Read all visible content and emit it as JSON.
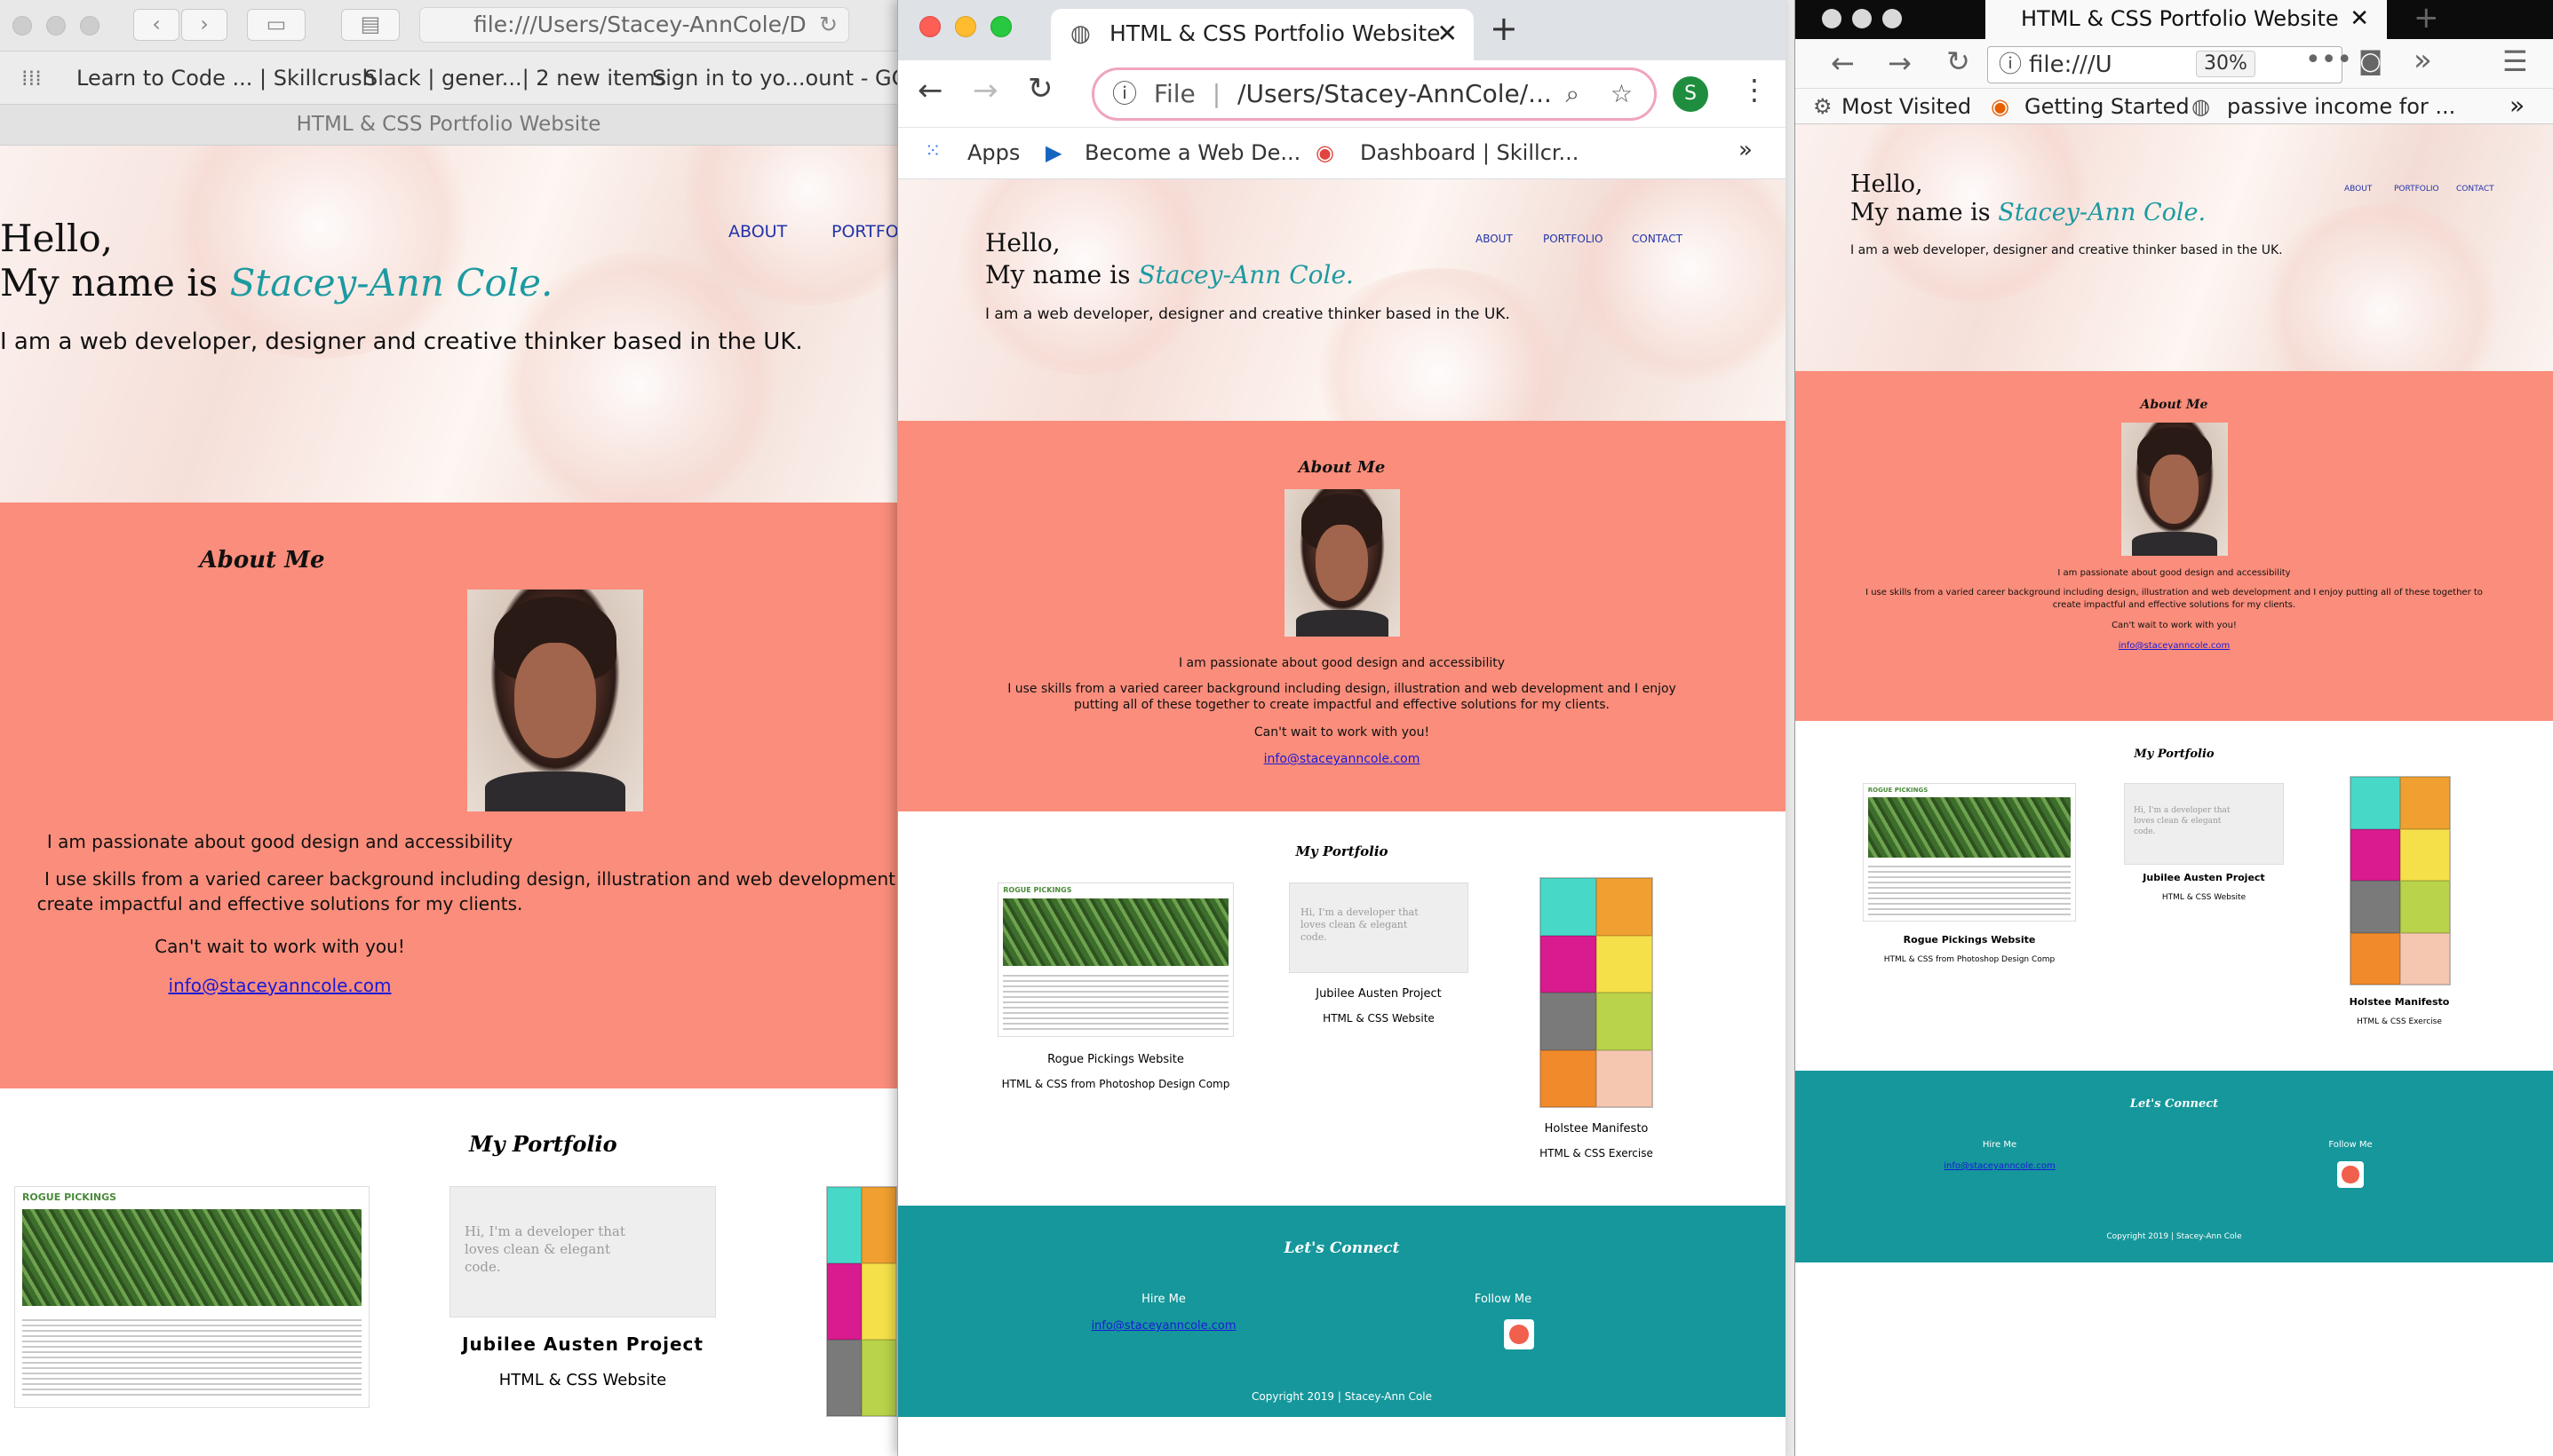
{
  "safari": {
    "url": "file:///Users/Stacey-AnnCole/D",
    "favorites": [
      "Learn to Code ... | Skillcrush",
      "Slack | gener...| 2 new items",
      "Sign in to yo...ount - GOV.U"
    ],
    "tab_title": "HTML & CSS Portfolio Website",
    "nav": [
      "ABOUT",
      "PORTFOLIO"
    ]
  },
  "chrome": {
    "tab_title": "HTML & CSS Portfolio Website",
    "url_scheme": "File",
    "url": "/Users/Stacey-AnnCole/...",
    "profile_initial": "S",
    "bookmarks": [
      "Apps",
      "Become a Web De...",
      "Dashboard | Skillcr..."
    ],
    "nav": [
      "ABOUT",
      "PORTFOLIO",
      "CONTACT"
    ]
  },
  "firefox": {
    "tab_title": "HTML & CSS Portfolio Website",
    "url": "file:///U",
    "zoom": "30%",
    "bookmarks": [
      "Most Visited",
      "Getting Started",
      "passive income for ..."
    ],
    "nav": [
      "ABOUT",
      "PORTFOLIO",
      "CONTACT"
    ]
  },
  "site": {
    "hello": "Hello,",
    "name_prefix": "My name is",
    "name": "Stacey-Ann Cole.",
    "tagline": "I am a web developer, designer and creative thinker based in the UK.",
    "tagline_safari": "I am a web developer, designer and creative thinker based in the UK.",
    "about_title": "About Me",
    "about_p1": "I am passionate about good design and accessibility",
    "about_p2": "I use skills from a varied career background including design, illustration and web development and I enjoy putting all of these together to create impactful and effective solutions for my clients.",
    "about_p2_safari_a": "I use skills from a varied career background including design, illustration and web development and I enjoy putting",
    "about_p2_safari_b": "create impactful and effective solutions for my clients.",
    "about_p3": "Can't wait to work with you!",
    "email": "info@staceyanncole.com",
    "portfolio_title": "My Portfolio",
    "projects": [
      {
        "title": "Rogue Pickings Website",
        "subtitle": "HTML & CSS from Photoshop Design Comp",
        "thumb_logo": "ROGUE PICKINGS"
      },
      {
        "title": "Jubilee Austen Project",
        "subtitle": "HTML & CSS Website",
        "thumb_text": "Hi, I'm a developer that loves clean & elegant code."
      },
      {
        "title": "Holstee Manifesto",
        "subtitle": "HTML & CSS Exercise"
      }
    ],
    "connect_title": "Let's Connect",
    "hire_me": "Hire Me",
    "follow_me": "Follow Me",
    "copyright": "Copyright 2019 | Stacey-Ann Cole"
  },
  "colors": {
    "about_bg": "#fa8d7b",
    "connect_bg": "#15979b",
    "name_accent": "#1c9aa1"
  }
}
